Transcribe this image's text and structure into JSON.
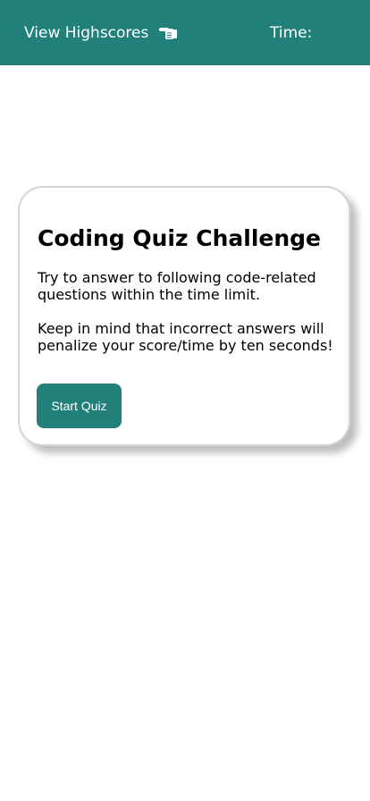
{
  "header": {
    "highscores_label": "View Highscores",
    "highscores_icon": "pointing-hand-icon",
    "timer_label": "Time:",
    "timer_value": "",
    "background_color": "#22807b"
  },
  "card": {
    "title": "Coding Quiz Challenge",
    "paragraph_1": "Try to answer to following code-related questions within the time limit.",
    "paragraph_2": "Keep in mind that incorrect answers will penalize your score/time by ten seconds!",
    "start_button_label": "Start Quiz",
    "accent_color": "#22807b"
  }
}
